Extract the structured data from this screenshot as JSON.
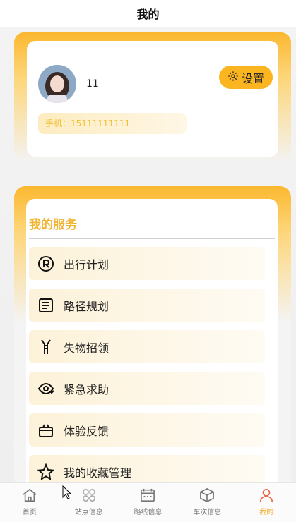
{
  "header": {
    "title": "我的"
  },
  "profile": {
    "username": "11",
    "settings_label": "设置",
    "phone_text": "手机：15111111111",
    "icons": {
      "settings": "gear-icon",
      "avatar": "user-avatar"
    }
  },
  "services": {
    "title": "我的服务",
    "items": [
      {
        "label": "出行计划",
        "icon": "registered-icon"
      },
      {
        "label": "路径规划",
        "icon": "document-icon"
      },
      {
        "label": "失物招领",
        "icon": "zipper-icon"
      },
      {
        "label": "紧急求助",
        "icon": "eye-alert-icon"
      },
      {
        "label": "体验反馈",
        "icon": "gift-icon"
      },
      {
        "label": "我的收藏管理",
        "icon": "star-icon"
      }
    ]
  },
  "tabbar": {
    "items": [
      {
        "label": "首页",
        "icon": "home-icon"
      },
      {
        "label": "站点信息",
        "icon": "grid-icon"
      },
      {
        "label": "路线信息",
        "icon": "calendar-icon"
      },
      {
        "label": "车次信息",
        "icon": "box-icon"
      },
      {
        "label": "我的",
        "icon": "user-icon",
        "active": true
      }
    ]
  },
  "colors": {
    "accent": "#fbb520",
    "accent_text": "#f2b533",
    "active_tab": "#f2a81d"
  }
}
